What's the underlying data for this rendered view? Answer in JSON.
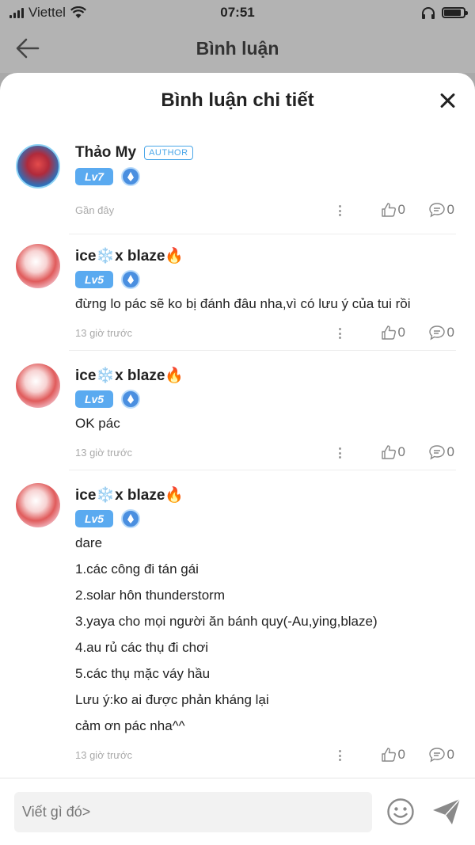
{
  "status_bar": {
    "carrier": "Viettel",
    "time": "07:51"
  },
  "header": {
    "title": "Bình luận"
  },
  "sheet": {
    "title": "Bình luận chi tiết"
  },
  "comments": [
    {
      "username": "Thảo My",
      "author_label": "AUTHOR",
      "level": "Lv7",
      "lines": [],
      "time": "Gần đây",
      "likes": "0",
      "replies": "0"
    },
    {
      "username": "ice❄️x blaze🔥",
      "level": "Lv5",
      "lines": [
        "đừng lo pác sẽ ko bị đánh đâu nha,vì có lưu ý của tui rồi"
      ],
      "time": "13 giờ trước",
      "likes": "0",
      "replies": "0"
    },
    {
      "username": "ice❄️x blaze🔥",
      "level": "Lv5",
      "lines": [
        "OK pác"
      ],
      "time": "13 giờ trước",
      "likes": "0",
      "replies": "0"
    },
    {
      "username": "ice❄️x blaze🔥",
      "level": "Lv5",
      "lines": [
        "dare",
        "1.các công đi tán gái",
        "2.solar hôn thunderstorm",
        "3.yaya cho mọi người ăn bánh quy(-Au,ying,blaze)",
        "4.au rủ các thụ đi chơi",
        "5.các thụ mặc váy hầu",
        "Lưu ý:ko ai được phản kháng lại",
        "cảm ơn pác nha^^"
      ],
      "time": "13 giờ trước",
      "likes": "0",
      "replies": "0"
    }
  ],
  "input": {
    "placeholder": "Viết gì đó>"
  },
  "icons": {
    "back": "arrow-left-icon",
    "close": "close-icon",
    "more": "more-vertical-icon",
    "like": "thumbs-up-icon",
    "reply": "comment-bubble-icon",
    "emoji": "smiley-icon",
    "send": "paper-plane-icon"
  },
  "colors": {
    "accent": "#4aa6e8",
    "level_badge": "#5aaaf0",
    "muted_text": "#aaaaaa"
  }
}
